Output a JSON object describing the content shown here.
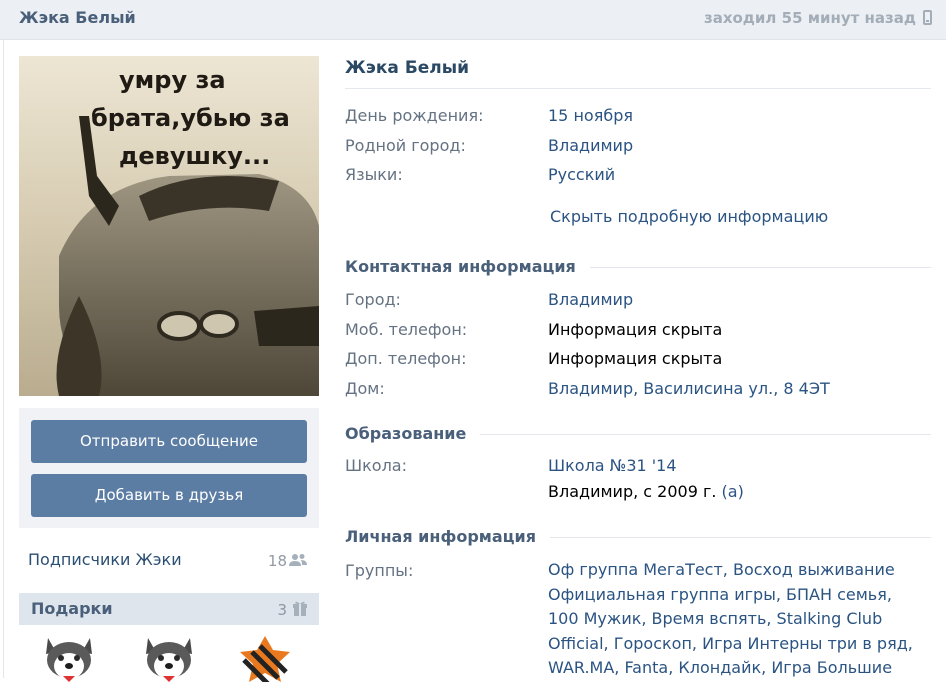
{
  "header": {
    "name": "Жэка Белый",
    "last_seen": "заходил 55 минут назад",
    "device_icon": "phone-icon"
  },
  "avatar": {
    "caption_lines": [
      "умру за",
      "брата,убью за",
      "девушку..."
    ]
  },
  "actions": {
    "send_message": "Отправить сообщение",
    "add_friend": "Добавить в друзья"
  },
  "followers": {
    "label": "Подписчики Жэки",
    "count": "18",
    "icon": "people-icon"
  },
  "gifts": {
    "title": "Подарки",
    "count": "3",
    "icon": "gift-icon",
    "items": [
      "husky-gift-icon",
      "husky-gift-icon",
      "ribbon-star-gift-icon"
    ]
  },
  "profile": {
    "name": "Жэка Белый",
    "basic": [
      {
        "label": "День рождения:",
        "value": "15 ноября"
      },
      {
        "label": "Родной город:",
        "value": "Владимир"
      },
      {
        "label": "Языки:",
        "value": "Русский"
      }
    ],
    "toggle_details": "Скрыть подробную информацию"
  },
  "contacts": {
    "title": "Контактная информация",
    "rows": [
      {
        "label": "Город:",
        "value": "Владимир"
      },
      {
        "label": "Моб. телефон:",
        "value": "Информация скрыта"
      },
      {
        "label": "Доп. телефон:",
        "value": "Информация скрыта"
      },
      {
        "label": "Дом:",
        "value": "Владимир, Василисина ул., 8 4ЭТ"
      }
    ]
  },
  "education": {
    "title": "Образование",
    "school_label": "Школа:",
    "school_name": "Школа №31 '14",
    "school_details": "Владимир, с 2009 г.",
    "school_details_link": "(а)"
  },
  "personal": {
    "title": "Личная информация",
    "groups_label": "Группы:",
    "groups_text": "Оф группа МегаТест, Восход выживание Официальная группа игры, БПАН семья, 100 Мужик, Время вспять, Stalking Club Official, Гороскоп, Игра Интерны три в ряд, WAR.MA, Fanta, Клондайк, Игра Большие"
  },
  "colors": {
    "link": "#2b5483",
    "button": "#5b7ca3",
    "header_bg": "#eceff3",
    "label": "#657282"
  }
}
